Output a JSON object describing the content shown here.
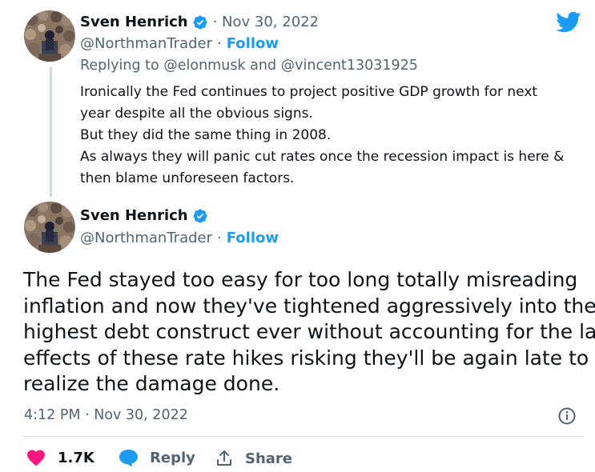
{
  "reply_tweet": {
    "author_name": "Sven Henrich",
    "dot_date": "· Nov 30, 2022",
    "handle": "@NorthmanTrader",
    "follow_label": "Follow",
    "replying_prefix": "Replying to",
    "reply_user_1": "@elonmusk",
    "reply_and": "and",
    "reply_user_2": "@vincent13031925",
    "lines": [
      "Ironically the Fed continues to project positive GDP growth for next",
      "year despite all the obvious signs.",
      "But they did the same thing in 2008.",
      "As always they will panic cut rates once the recession impact is here &",
      "then blame unforeseen factors."
    ]
  },
  "main_tweet": {
    "author_name": "Sven Henrich",
    "handle": "@NorthmanTrader",
    "follow_label": "Follow",
    "lines": [
      "The Fed stayed too easy for too long totally misreading",
      "inflation and now they've tightened aggressively into the",
      "highest debt construct ever without accounting for the lag",
      "effects of these rate hikes risking they'll be again late to",
      "realize the damage done."
    ],
    "timestamp": "4:12 PM · Nov 30, 2022"
  },
  "actions": {
    "like_count": "1.7K",
    "reply_label": "Reply",
    "share_label": "Share"
  },
  "icons": {
    "brand": "twitter-bird-icon",
    "verified": "verified-badge-icon",
    "info": "info-icon",
    "like": "heart-icon",
    "reply": "speech-bubble-icon",
    "share": "share-icon"
  },
  "colors": {
    "twitter_blue": "#1d9bf0",
    "like_pink": "#f91880",
    "muted_gray": "#536471",
    "text": "#0f1419",
    "divider": "#cfd9de"
  }
}
